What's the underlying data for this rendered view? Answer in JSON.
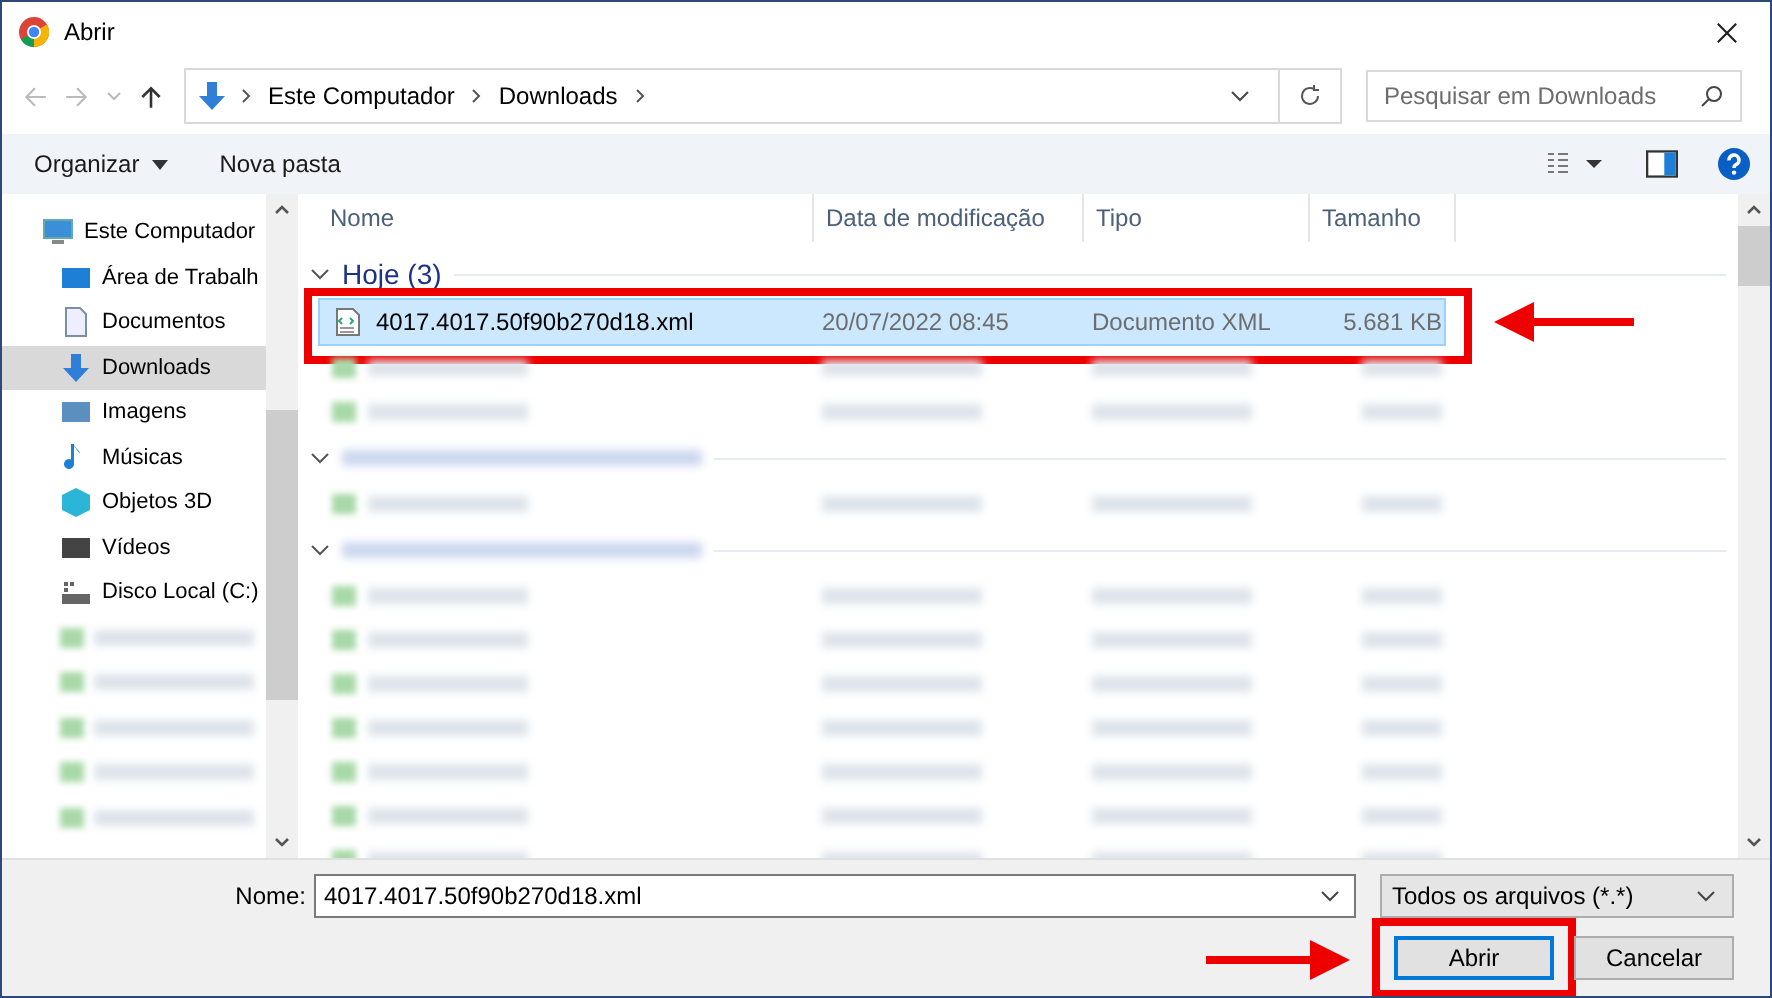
{
  "window": {
    "title": "Abrir"
  },
  "nav": {
    "path": [
      "Este Computador",
      "Downloads"
    ],
    "search_placeholder": "Pesquisar em Downloads"
  },
  "toolbar": {
    "organize": "Organizar",
    "new_folder": "Nova pasta"
  },
  "sidebar": {
    "items": [
      {
        "kind": "computer",
        "label": "Este Computador",
        "selected": false,
        "children": [
          {
            "kind": "desktop",
            "label": "Área de Trabalh",
            "selected": false
          },
          {
            "kind": "document",
            "label": "Documentos",
            "selected": false
          },
          {
            "kind": "download",
            "label": "Downloads",
            "selected": true
          },
          {
            "kind": "image",
            "label": "Imagens",
            "selected": false
          },
          {
            "kind": "music",
            "label": "Músicas",
            "selected": false
          },
          {
            "kind": "cube",
            "label": "Objetos 3D",
            "selected": false
          },
          {
            "kind": "video",
            "label": "Vídeos",
            "selected": false
          },
          {
            "kind": "drive",
            "label": "Disco Local (C:)",
            "selected": false
          },
          {
            "kind": "blurred",
            "selected": false
          },
          {
            "kind": "blurred",
            "selected": false
          },
          {
            "kind": "blurred",
            "selected": false
          },
          {
            "kind": "blurred",
            "selected": false
          },
          {
            "kind": "blurred",
            "selected": false
          }
        ]
      }
    ]
  },
  "columns": [
    "Nome",
    "Data de modificação",
    "Tipo",
    "Tamanho"
  ],
  "groups": [
    {
      "label": "Hoje (3)",
      "rows": [
        {
          "kind": "file",
          "name": "4017.4017.50f90b270d18.xml",
          "date": "20/07/2022 08:45",
          "type": "Documento XML",
          "size": "5.681 KB",
          "selected": true,
          "highlighted": true
        },
        {
          "kind": "blurred",
          "selected": false
        },
        {
          "kind": "blurred",
          "selected": false
        }
      ]
    },
    {
      "rows": [
        {
          "kind": "blurred",
          "selected": false
        }
      ]
    },
    {
      "rows": [
        {
          "kind": "blurred",
          "selected": false
        },
        {
          "kind": "blurred",
          "selected": false
        },
        {
          "kind": "blurred",
          "selected": false
        },
        {
          "kind": "blurred",
          "selected": false
        },
        {
          "kind": "blurred",
          "selected": false
        },
        {
          "kind": "blurred",
          "selected": false
        },
        {
          "kind": "blurred",
          "selected": false
        }
      ]
    }
  ],
  "footer": {
    "name_label": "Nome:",
    "name_value": "4017.4017.50f90b270d18.xml",
    "filter": "Todos os arquivos (*.*)",
    "buttons": [
      {
        "label": "Abrir",
        "default": true,
        "highlighted": true
      },
      {
        "label": "Cancelar",
        "default": false,
        "highlighted": false
      }
    ]
  }
}
